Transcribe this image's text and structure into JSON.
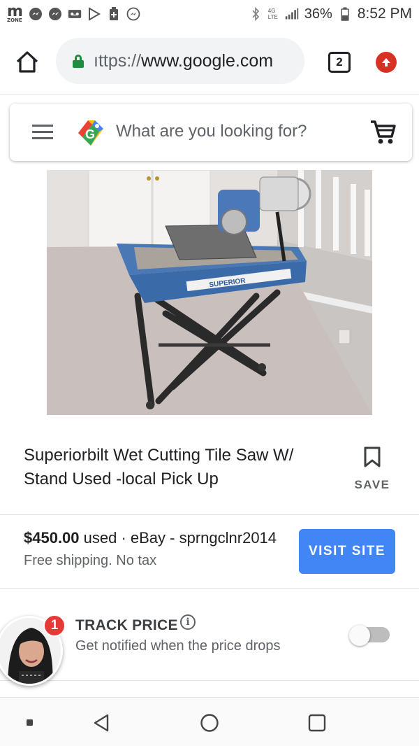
{
  "status_bar": {
    "carrier_logo": "m",
    "carrier_logo_sub": "ZONE",
    "network": "4G LTE",
    "battery": "36%",
    "time": "8:52 PM",
    "left_icons": [
      "messenger-icon",
      "messenger-icon",
      "voicemail-icon",
      "play-store-icon",
      "battery-saver-icon",
      "messenger-icon"
    ],
    "right_icons": [
      "bluetooth-icon",
      "signal-icon",
      "battery-icon"
    ]
  },
  "browser": {
    "url": "ittps://www.google.com",
    "url_display_prefix": "ıttps://",
    "url_display_domain": "www.google.com",
    "tab_count": "2"
  },
  "search": {
    "placeholder": "What are you looking for?"
  },
  "product": {
    "title": "Superiorbilt Wet Cutting Tile Saw W/ Stand Used -local Pick Up",
    "save_label": "SAVE",
    "image_label": "SUPERIOR"
  },
  "offer": {
    "price": "$450.00",
    "condition": " used · eBay - sprngclnr2014",
    "shipping": "Free shipping. No tax",
    "visit_label": "VISIT SITE"
  },
  "track_price": {
    "title": "TRACK PRICE",
    "subtitle": "Get notified when the price drops",
    "enabled": false
  },
  "chat_head": {
    "badge_count": "1"
  },
  "colors": {
    "accent_blue": "#4285f4",
    "lock_green": "#1e8e3e",
    "update_red": "#d93025",
    "badge_red": "#e53935"
  }
}
